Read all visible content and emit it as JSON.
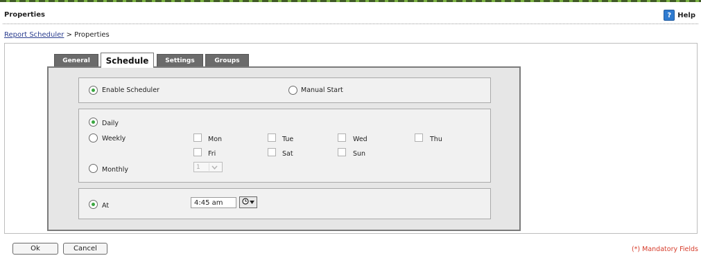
{
  "header": {
    "title": "Properties",
    "help_label": "Help",
    "help_icon": "help-question-icon"
  },
  "breadcrumb": {
    "parent": "Report Scheduler",
    "separator": ">",
    "current": "Properties"
  },
  "tabs": [
    {
      "label": "General",
      "active": false
    },
    {
      "label": "Schedule",
      "active": true
    },
    {
      "label": "Settings",
      "active": false
    },
    {
      "label": "Groups",
      "active": false
    }
  ],
  "mode": {
    "enable_scheduler": {
      "label": "Enable Scheduler",
      "selected": true
    },
    "manual_start": {
      "label": "Manual Start",
      "selected": false
    }
  },
  "frequency": {
    "daily": {
      "label": "Daily",
      "selected": true
    },
    "weekly": {
      "label": "Weekly",
      "selected": false
    },
    "monthly": {
      "label": "Monthly",
      "selected": false
    },
    "days": {
      "mon": "Mon",
      "tue": "Tue",
      "wed": "Wed",
      "thu": "Thu",
      "fri": "Fri",
      "sat": "Sat",
      "sun": "Sun"
    },
    "monthly_day_value": "1"
  },
  "time": {
    "at_label": "At",
    "at_selected": true,
    "value": "4:45 am",
    "picker_icon": "clock-dropdown-icon"
  },
  "footer": {
    "ok_label": "Ok",
    "cancel_label": "Cancel",
    "mandatory_note": "(*) Mandatory Fields"
  },
  "colors": {
    "accent_green": "#7cb342",
    "radio_selected": "#3aa640",
    "mandatory_red": "#d63b2a",
    "link_blue": "#2a3d8f",
    "tab_inactive": "#6b6b6b"
  }
}
